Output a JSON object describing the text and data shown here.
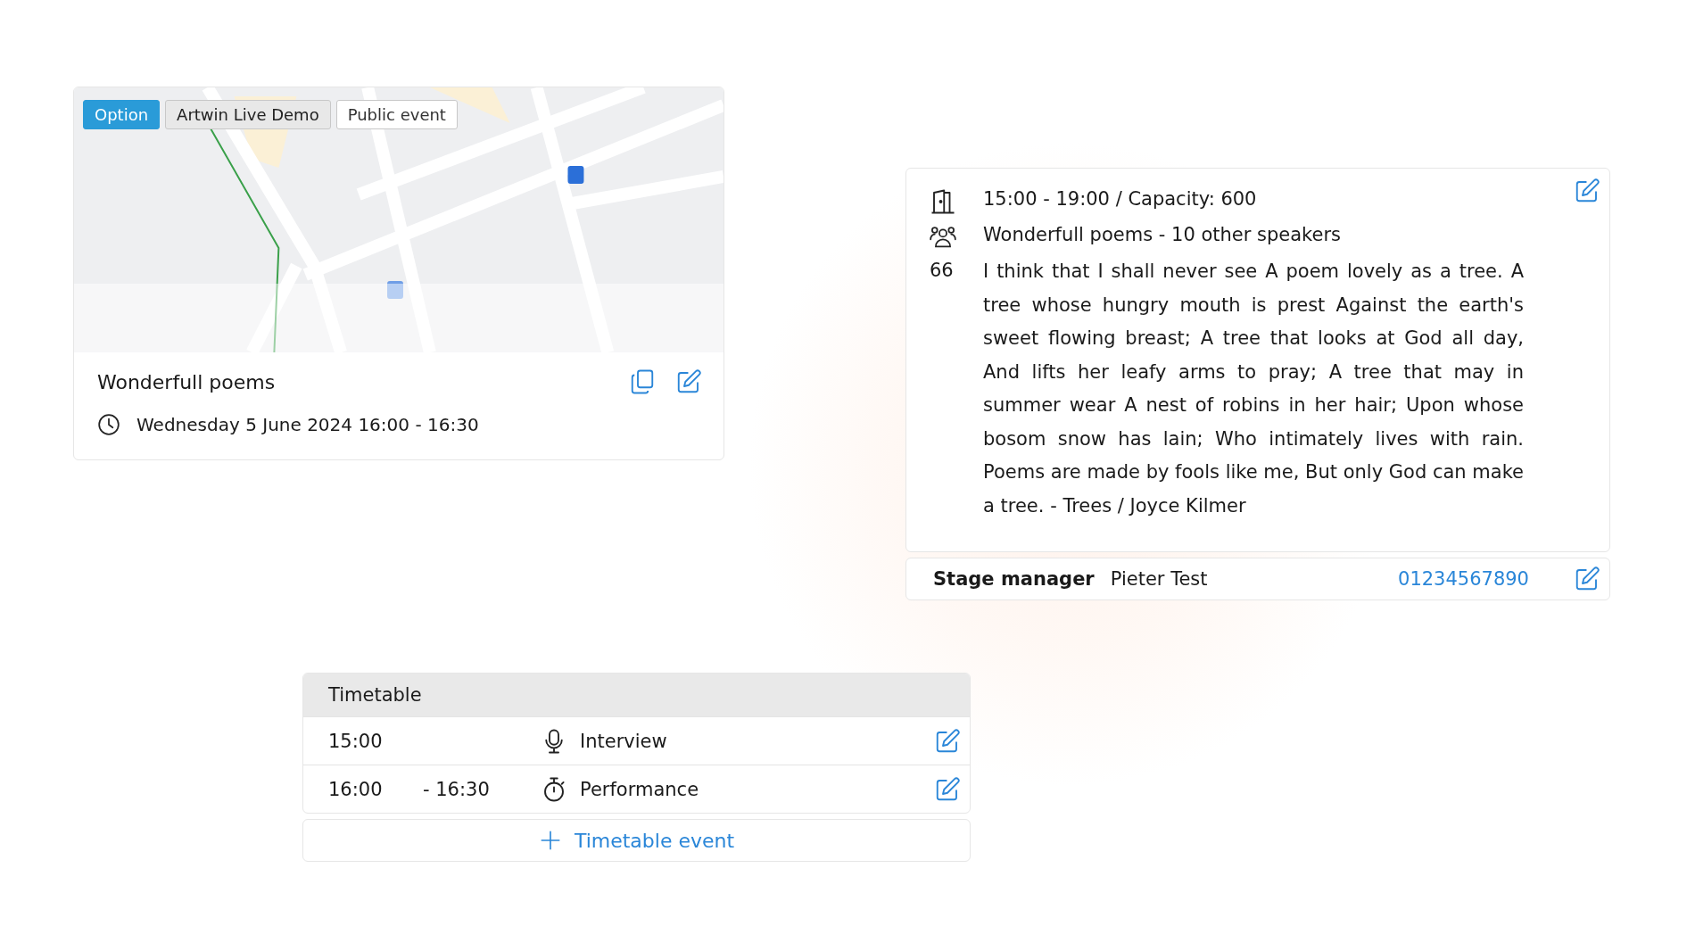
{
  "event_card": {
    "tags": [
      {
        "label": "Option",
        "kind": "primary"
      },
      {
        "label": "Artwin Live Demo",
        "kind": "neutral"
      },
      {
        "label": "Public event",
        "kind": "outline"
      }
    ],
    "title": "Wonderfull poems",
    "datetime": "Wednesday 5 June 2024 16:00 - 16:30"
  },
  "details": {
    "rows": [
      {
        "kind": "room",
        "text": "15:00 - 19:00 / Capacity: 600"
      },
      {
        "kind": "speakers",
        "text": "Wonderfull poems - 10 other speakers"
      },
      {
        "kind": "quote",
        "marker": "66",
        "text": "I think that I shall never see A poem lovely as a tree. A tree whose hungry mouth is prest Against the earth's sweet flowing breast; A tree that looks at God all day, And lifts her leafy arms to pray; A tree that may in summer wear A nest of robins in her hair; Upon whose bosom snow has lain; Who intimately lives with rain. Poems are made by fools like me, But only God can make a tree. - Trees / Joyce Kilmer"
      }
    ]
  },
  "contact": {
    "role": "Stage manager",
    "name": "Pieter Test",
    "phone": "01234567890"
  },
  "timetable": {
    "title": "Timetable",
    "rows": [
      {
        "start": "15:00",
        "kind": "interview",
        "label": "Interview"
      },
      {
        "start": "16:00",
        "end": "- 16:30",
        "kind": "performance",
        "label": "Performance"
      }
    ],
    "add_button": "Timetable event"
  }
}
